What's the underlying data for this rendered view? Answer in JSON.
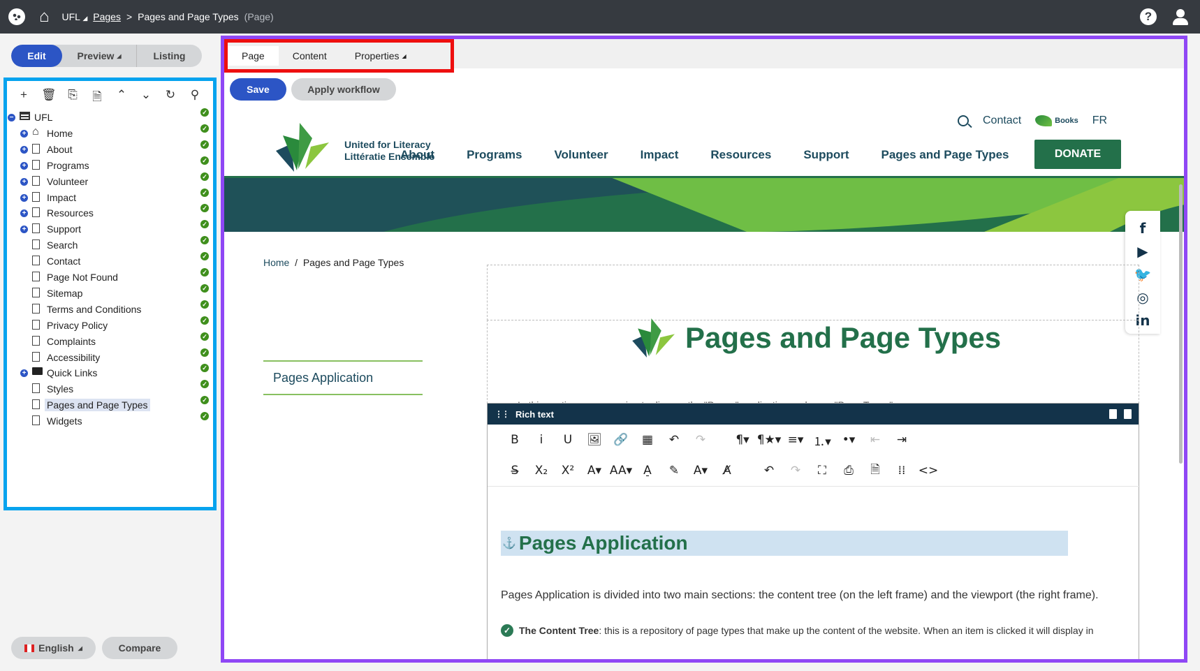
{
  "topbar": {
    "root": "UFL",
    "root_caret": "◢",
    "crumb_link": "Pages",
    "crumb_sep": ">",
    "current": "Pages and Page Types",
    "current_type": "(Page)"
  },
  "modes": {
    "edit": "Edit",
    "preview": "Preview",
    "preview_caret": "◢",
    "listing": "Listing"
  },
  "tree_tools": [
    "+",
    "🗑",
    "⎘",
    "🗎",
    "⌃",
    "⌄",
    "↻",
    "⚲"
  ],
  "tree": [
    {
      "label": "UFL",
      "icon": "root-icon",
      "exp": "−",
      "level": 0
    },
    {
      "label": "Home",
      "icon": "house-icon",
      "exp": "+",
      "level": 1
    },
    {
      "label": "About",
      "icon": "doc-icon",
      "exp": "+",
      "level": 1
    },
    {
      "label": "Programs",
      "icon": "doc-icon",
      "exp": "+",
      "level": 1
    },
    {
      "label": "Volunteer",
      "icon": "doc-icon",
      "exp": "+",
      "level": 1
    },
    {
      "label": "Impact",
      "icon": "doc-icon",
      "exp": "+",
      "level": 1
    },
    {
      "label": "Resources",
      "icon": "doc-icon",
      "exp": "+",
      "level": 1
    },
    {
      "label": "Support",
      "icon": "doc-icon",
      "exp": "+",
      "level": 1
    },
    {
      "label": "Search",
      "icon": "doc-icon",
      "exp": "",
      "level": 1
    },
    {
      "label": "Contact",
      "icon": "doc-icon",
      "exp": "",
      "level": 1
    },
    {
      "label": "Page Not Found",
      "icon": "doc-icon",
      "exp": "",
      "level": 1
    },
    {
      "label": "Sitemap",
      "icon": "doc-icon",
      "exp": "",
      "level": 1
    },
    {
      "label": "Terms and Conditions",
      "icon": "doc-icon",
      "exp": "",
      "level": 1
    },
    {
      "label": "Privacy Policy",
      "icon": "doc-icon",
      "exp": "",
      "level": 1
    },
    {
      "label": "Complaints",
      "icon": "doc-icon",
      "exp": "",
      "level": 1
    },
    {
      "label": "Accessibility",
      "icon": "doc-icon",
      "exp": "",
      "level": 1
    },
    {
      "label": "Quick Links",
      "icon": "folder-icon",
      "exp": "+",
      "level": 1
    },
    {
      "label": "Styles",
      "icon": "doc-icon",
      "exp": "",
      "level": 1
    },
    {
      "label": "Pages and Page Types",
      "icon": "doc-icon",
      "exp": "",
      "level": 1,
      "selected": true
    },
    {
      "label": "Widgets",
      "icon": "doc-icon",
      "exp": "",
      "level": 1
    }
  ],
  "bottom": {
    "language": "English",
    "language_caret": "◢",
    "compare": "Compare"
  },
  "tabs": {
    "page": "Page",
    "content": "Content",
    "properties": "Properties",
    "properties_caret": "◢"
  },
  "actions": {
    "save": "Save",
    "workflow": "Apply workflow"
  },
  "site": {
    "brand_line1": "United for Literacy",
    "brand_line2": "Littératie Ensemble",
    "contact": "Contact",
    "books": "Books",
    "lang": "FR",
    "nav": [
      "About",
      "Programs",
      "Volunteer",
      "Impact",
      "Resources",
      "Support",
      "Pages and Page Types"
    ],
    "donate": "DONATE",
    "social": [
      "f",
      "▶",
      "🐦",
      "◎",
      "in"
    ],
    "breadcrumb_home": "Home",
    "breadcrumb_sep": "/",
    "breadcrumb_current": "Pages and Page Types",
    "side_link": "Pages Application",
    "title": "Pages and Page Types",
    "intro": "In this section, we are going to discuss the \"Pages\" application and page \"Page Types\"."
  },
  "rte": {
    "header": "Rich text",
    "toolbar1": [
      "B",
      "i",
      "U",
      "🖼",
      "🔗",
      "▦",
      "↶",
      "↷",
      "",
      "¶▾",
      "¶★▾",
      "≡▾",
      "⒈▾",
      "•▾",
      "⇤",
      "⇥"
    ],
    "toolbar2": [
      "S̶",
      "X₂",
      "X²",
      "A▾",
      "AA▾",
      "A̠",
      "✎",
      "A▾",
      "A̸",
      "",
      "↶",
      "↷",
      "⛶",
      "⎙",
      "🗎",
      "⁞⁞",
      "<>"
    ],
    "heading": "Pages Application",
    "anchor": "⚓",
    "paragraph": "Pages Application is divided into two main sections: the content tree (on the left frame) and the viewport (the right frame).",
    "bullet_bold": "The Content Tree",
    "bullet_text": ": this is a repository of page types that make up the content of the website. When an item is clicked it will display in"
  },
  "colors": {
    "primary": "#2c55c5",
    "tree_border": "#06a3ee",
    "view_border": "#8f47f5",
    "tabs_border": "#ee0f0f",
    "brand_green": "#23704a",
    "brand_navy": "#1d4b5e"
  }
}
